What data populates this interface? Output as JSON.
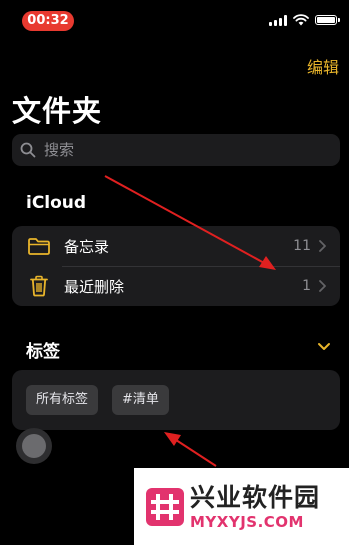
{
  "status_bar": {
    "time": "00:32",
    "time_pill_color": "#e83a30",
    "icons": [
      "cellular-signal-icon",
      "wifi-icon",
      "battery-icon"
    ]
  },
  "header": {
    "edit_label": "编辑",
    "title": "文件夹",
    "accent_color": "#e9b52b"
  },
  "search": {
    "placeholder": "搜索",
    "value": ""
  },
  "icloud": {
    "section_title": "iCloud",
    "folders": [
      {
        "label": "备忘录",
        "count": "11",
        "icon": "folder-icon"
      },
      {
        "label": "最近删除",
        "count": "1",
        "icon": "trash-icon"
      }
    ]
  },
  "tags": {
    "section_title": "标签",
    "chips": [
      "所有标签",
      "#清单"
    ]
  },
  "watermark": {
    "name": "兴业软件园",
    "url": "MYXYJS.COM"
  }
}
